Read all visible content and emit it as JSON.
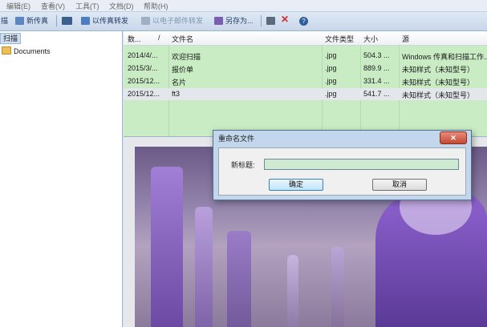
{
  "menu": {
    "items": [
      "编辑(E)",
      "查看(V)",
      "工具(T)",
      "文档(D)",
      "帮助(H)"
    ]
  },
  "toolbar": {
    "scan_label": "描",
    "new_fax_label": "新传真",
    "fax_forward_label": "以传真转发",
    "email_forward_label": "以电子邮件转发",
    "save_as_label": "另存为..."
  },
  "tree": {
    "header": "扫描",
    "documents": "Documents"
  },
  "filelist": {
    "columns": [
      "数...",
      "/",
      "文件名",
      "文件类型",
      "大小",
      "源"
    ],
    "rows": [
      {
        "date": "2014/4/...",
        "name": "欢迎扫描",
        "type": ".jpg",
        "size": "504.3 ...",
        "source": "Windows 传真和扫描工作..."
      },
      {
        "date": "2015/3/...",
        "name": "报价单",
        "type": ".jpg",
        "size": "889.9 ...",
        "source": "未知样式（未知型号）"
      },
      {
        "date": "2015/12...",
        "name": "名片",
        "type": ".jpg",
        "size": "331.4 ...",
        "source": "未知样式（未知型号）"
      },
      {
        "date": "2015/12...",
        "name": "ft3",
        "type": ".jpg",
        "size": "541.7 ...",
        "source": "未知样式（未知型号）"
      }
    ]
  },
  "dialog": {
    "title": "重命名文件",
    "close": "✕",
    "label": "新标题:",
    "value": "",
    "ok": "确定",
    "cancel": "取消"
  }
}
